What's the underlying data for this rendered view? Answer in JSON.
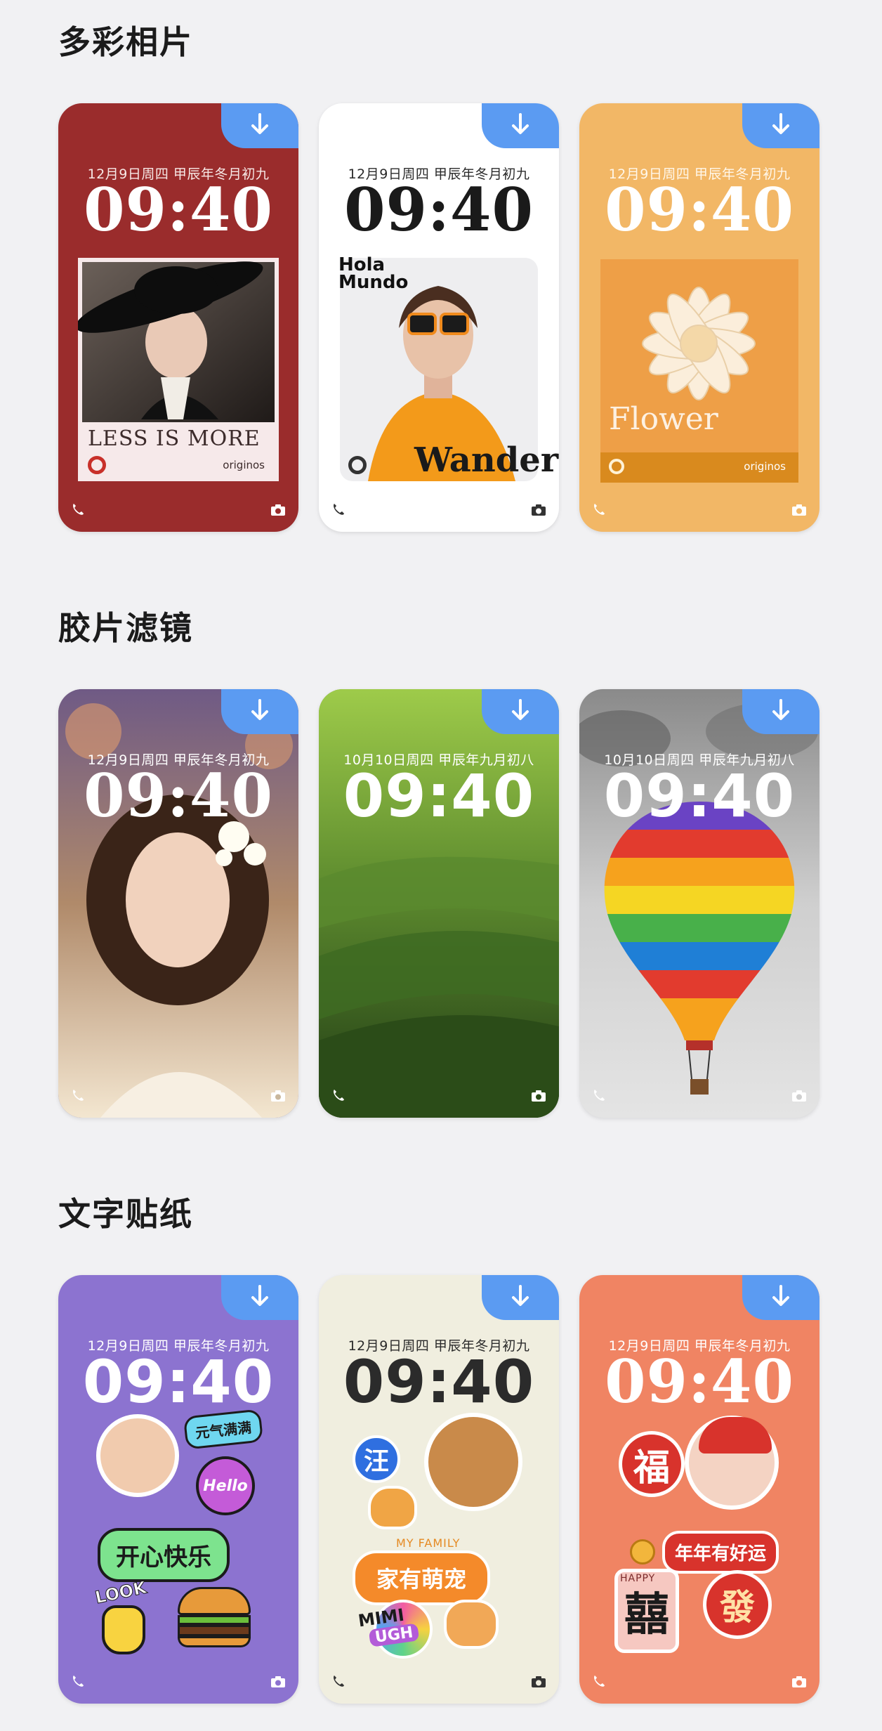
{
  "sections": [
    {
      "title": "多彩相片",
      "cards": [
        {
          "date": "12月9日周四 甲辰年冬月初九",
          "time": "09:40",
          "caption": "LESS IS MORE",
          "brand": "originos"
        },
        {
          "date": "12月9日周四 甲辰年冬月初九",
          "time": "09:40",
          "caption": "Wander",
          "side_text": "Hola Mundo"
        },
        {
          "date": "12月9日周四 甲辰年冬月初九",
          "time": "09:40",
          "caption": "Flower",
          "brand": "originos"
        }
      ]
    },
    {
      "title": "胶片滤镜",
      "cards": [
        {
          "date": "12月9日周四 甲辰年冬月初九",
          "time": "09:40"
        },
        {
          "date": "10月10日周四 甲辰年九月初八",
          "time": "09:40"
        },
        {
          "date": "10月10日周四 甲辰年九月初八",
          "time": "09:40"
        }
      ]
    },
    {
      "title": "文字贴纸",
      "cards": [
        {
          "date": "12月9日周四 甲辰年冬月初九",
          "time": "09:40",
          "stickers": [
            "元气满满",
            "Hello",
            "开心快乐",
            "LOOK"
          ]
        },
        {
          "date": "12月9日周四 甲辰年冬月初九",
          "time": "09:40",
          "stickers": [
            "汪",
            "MY FAMILY",
            "家有萌宠",
            "MIMI",
            "UGH"
          ]
        },
        {
          "date": "12月9日周四 甲辰年冬月初九",
          "time": "09:40",
          "stickers": [
            "福",
            "年年有好运",
            "囍",
            "發",
            "HAPPY"
          ]
        }
      ]
    }
  ],
  "icons": {
    "download": "download-arrow-icon",
    "phone": "phone-icon",
    "camera": "camera-icon"
  },
  "colors": {
    "download_badge": "#5b9bf2",
    "card_red": "#9a2c2c",
    "card_orange": "#f2b766",
    "card_purple": "#8c73d0",
    "card_cream": "#f0eedf",
    "card_coral": "#f08463"
  }
}
